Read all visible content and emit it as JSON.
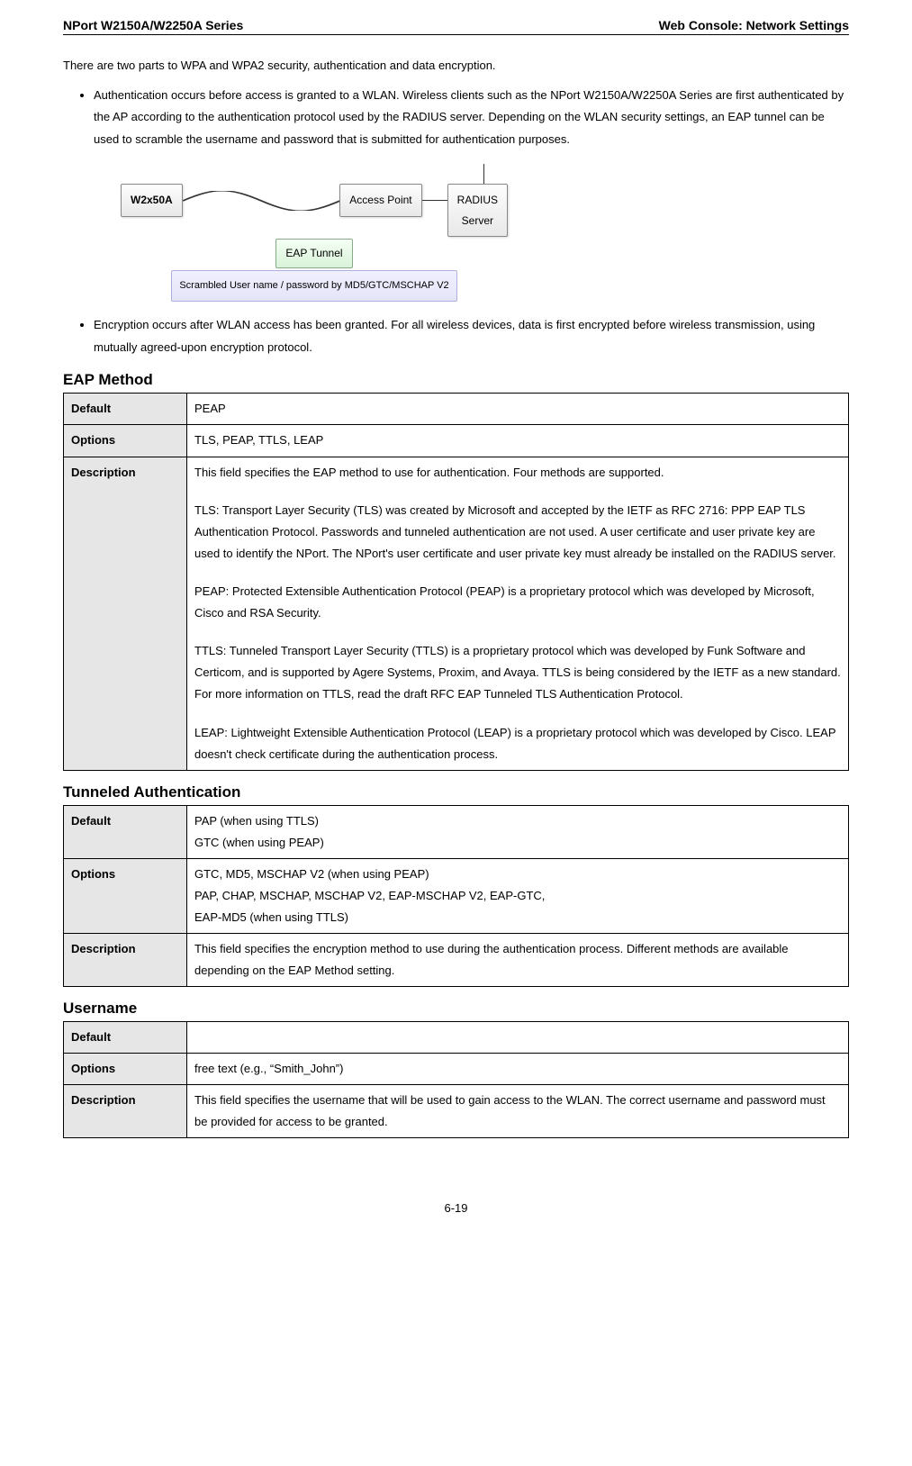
{
  "header": {
    "left": "NPort W2150A/W2250A Series",
    "right": "Web Console: Network Settings"
  },
  "intro": "There are two parts to WPA and WPA2 security, authentication and data encryption.",
  "bullets": {
    "auth": "Authentication occurs before access is granted to a WLAN. Wireless clients such as the NPort W2150A/W2250A Series are first authenticated by the AP according to the authentication protocol used by the RADIUS server. Depending on the WLAN security settings, an EAP tunnel can be used to scramble the username and password that is submitted for authentication purposes.",
    "enc": "Encryption occurs after WLAN access has been granted. For all wireless devices, data is first encrypted before wireless transmission, using mutually agreed-upon encryption protocol."
  },
  "diagram": {
    "device": "W2x50A",
    "ap": "Access Point",
    "radius_line1": "RADIUS",
    "radius_line2": "Server",
    "eap_tunnel": "EAP Tunnel",
    "scramble": "Scrambled User name / password by MD5/GTC/MSCHAP V2"
  },
  "sections": {
    "eap_method": {
      "title": "EAP Method",
      "default": "PEAP",
      "options": "TLS, PEAP, TTLS, LEAP",
      "desc_intro": "This field specifies the EAP method to use for authentication. Four methods are supported.",
      "desc_tls": "TLS: Transport Layer Security (TLS) was created by Microsoft and accepted by the IETF as RFC 2716: PPP EAP TLS Authentication Protocol. Passwords and tunneled authentication are not used. A user certificate and user private key are used to identify the NPort. The NPort's user certificate and user private key must already be installed on the RADIUS server.",
      "desc_peap": "PEAP: Protected Extensible Authentication Protocol (PEAP) is a proprietary protocol which was developed by Microsoft, Cisco and RSA Security.",
      "desc_ttls": "TTLS: Tunneled Transport Layer Security (TTLS) is a proprietary protocol which was developed by Funk Software and Certicom, and is supported by Agere Systems, Proxim, and Avaya. TTLS is being considered by the IETF as a new standard. For more information on TTLS, read the draft RFC EAP Tunneled TLS Authentication Protocol.",
      "desc_leap": "LEAP: Lightweight Extensible Authentication Protocol (LEAP) is a proprietary protocol which was developed by Cisco. LEAP doesn't check certificate during the authentication process."
    },
    "tunneled": {
      "title": "Tunneled Authentication",
      "default_line1": "PAP (when using TTLS)",
      "default_line2": "GTC (when using PEAP)",
      "options_line1": "GTC, MD5, MSCHAP V2 (when using PEAP)",
      "options_line2": "PAP, CHAP, MSCHAP, MSCHAP V2, EAP-MSCHAP V2, EAP-GTC,",
      "options_line3": "EAP-MD5 (when using TTLS)",
      "desc": "This field specifies the encryption method to use during the authentication process. Different methods are available depending on the EAP Method setting."
    },
    "username": {
      "title": "Username",
      "default": "",
      "options": "free text (e.g., “Smith_John”)",
      "desc": "This field specifies the username that will be used to gain access to the WLAN. The correct username and password must be provided for access to be granted."
    }
  },
  "labels": {
    "default": "Default",
    "options": "Options",
    "description": "Description"
  },
  "footer": "6-19"
}
